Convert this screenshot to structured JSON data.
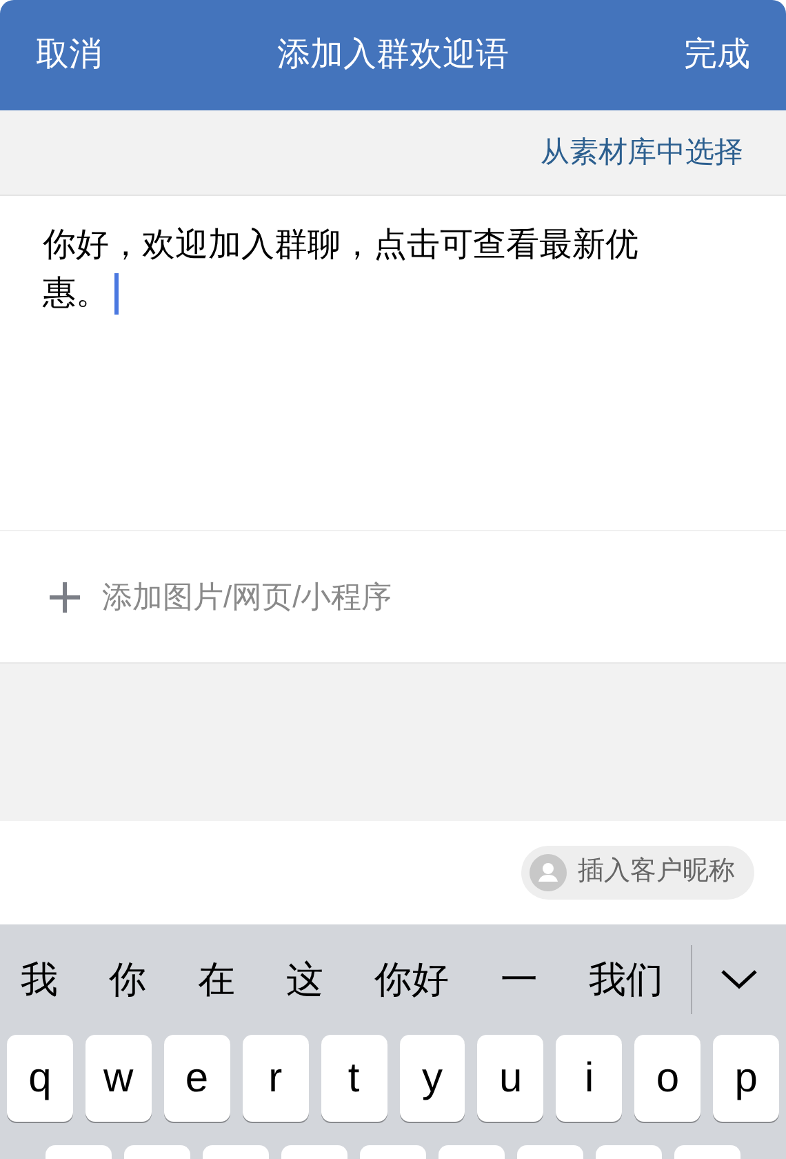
{
  "header": {
    "cancel": "取消",
    "title": "添加入群欢迎语",
    "done": "完成"
  },
  "library_link": "从素材库中选择",
  "message": {
    "lines": [
      "你好，欢迎加入群聊，点击可查看最新优",
      "惠。"
    ]
  },
  "attachment": {
    "label": "添加图片/网页/小程序"
  },
  "nickname_chip": "插入客户昵称",
  "keyboard": {
    "candidates": [
      "我",
      "你",
      "在",
      "这",
      "你好",
      "一",
      "我们"
    ],
    "keys": [
      "q",
      "w",
      "e",
      "r",
      "t",
      "y",
      "u",
      "i",
      "o",
      "p"
    ]
  }
}
